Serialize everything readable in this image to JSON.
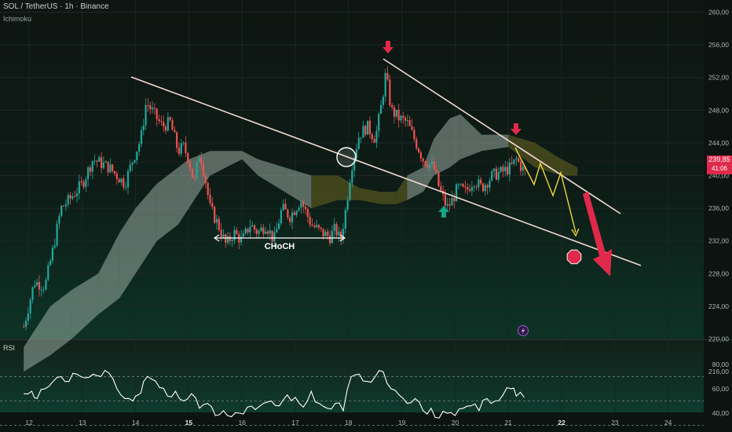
{
  "header": {
    "symbol_line": "SOL / TetherUS · 1h · Binance",
    "indicator": "Ichimoku"
  },
  "colors": {
    "up": "#26a69a",
    "down": "#ef5350",
    "cloud_bull": "#b6c9c1",
    "cloud_bear": "#6b6620",
    "trendline": "#f2d9d2",
    "arrow_down": "#e0294a",
    "arrow_up": "#14a384",
    "projection": "#f1d63a",
    "rsi_line": "#ffffff",
    "price_tag": "#e0294a"
  },
  "icons": {
    "lightning": "lightning-icon",
    "target": "octagon-target-icon"
  },
  "price_tag": {
    "price": "239,85",
    "countdown": "41:06"
  },
  "chart_data": [
    {
      "type": "candlestick",
      "title": "SOL / TetherUS · 1h · Binance",
      "ylim": [
        216,
        262
      ],
      "y_ticks": [
        "260,00",
        "256,00",
        "252,00",
        "248,00",
        "244,00",
        "240,00",
        "236,00",
        "232,00",
        "228,00",
        "224,00",
        "220,00",
        "216,00"
      ],
      "x_ticks": [
        "12",
        "13",
        "14",
        "15",
        "16",
        "17",
        "18",
        "19",
        "20",
        "21",
        "22",
        "23",
        "24"
      ],
      "close_path": [
        {
          "x": 11.9,
          "y": 221.5
        },
        {
          "x": 12.1,
          "y": 227
        },
        {
          "x": 12.3,
          "y": 226.5
        },
        {
          "x": 12.45,
          "y": 231
        },
        {
          "x": 12.6,
          "y": 236
        },
        {
          "x": 12.75,
          "y": 237
        },
        {
          "x": 13.0,
          "y": 239
        },
        {
          "x": 13.2,
          "y": 242
        },
        {
          "x": 13.35,
          "y": 241.5
        },
        {
          "x": 13.5,
          "y": 241
        },
        {
          "x": 13.8,
          "y": 239
        },
        {
          "x": 13.95,
          "y": 242
        },
        {
          "x": 14.1,
          "y": 244.5
        },
        {
          "x": 14.2,
          "y": 249
        },
        {
          "x": 14.35,
          "y": 247.5
        },
        {
          "x": 14.5,
          "y": 246
        },
        {
          "x": 14.65,
          "y": 246.5
        },
        {
          "x": 14.8,
          "y": 243
        },
        {
          "x": 14.9,
          "y": 243.5
        },
        {
          "x": 15.0,
          "y": 242
        },
        {
          "x": 15.1,
          "y": 239
        },
        {
          "x": 15.2,
          "y": 243
        },
        {
          "x": 15.3,
          "y": 240
        },
        {
          "x": 15.4,
          "y": 236
        },
        {
          "x": 15.55,
          "y": 234
        },
        {
          "x": 15.7,
          "y": 231.5
        },
        {
          "x": 15.85,
          "y": 233
        },
        {
          "x": 16.0,
          "y": 232
        },
        {
          "x": 16.15,
          "y": 234
        },
        {
          "x": 16.3,
          "y": 233
        },
        {
          "x": 16.45,
          "y": 234
        },
        {
          "x": 16.6,
          "y": 232
        },
        {
          "x": 16.75,
          "y": 236
        },
        {
          "x": 16.9,
          "y": 235
        },
        {
          "x": 17.1,
          "y": 237
        },
        {
          "x": 17.3,
          "y": 234
        },
        {
          "x": 17.5,
          "y": 233
        },
        {
          "x": 17.65,
          "y": 232.5
        },
        {
          "x": 17.75,
          "y": 233.5
        },
        {
          "x": 17.85,
          "y": 232
        },
        {
          "x": 17.95,
          "y": 236
        },
        {
          "x": 18.05,
          "y": 241
        },
        {
          "x": 18.2,
          "y": 245
        },
        {
          "x": 18.35,
          "y": 246
        },
        {
          "x": 18.5,
          "y": 244.5
        },
        {
          "x": 18.6,
          "y": 248
        },
        {
          "x": 18.7,
          "y": 252.5
        },
        {
          "x": 18.8,
          "y": 248
        },
        {
          "x": 18.95,
          "y": 247
        },
        {
          "x": 19.1,
          "y": 246.5
        },
        {
          "x": 19.2,
          "y": 245
        },
        {
          "x": 19.4,
          "y": 242
        },
        {
          "x": 19.6,
          "y": 241
        },
        {
          "x": 19.7,
          "y": 238.5
        },
        {
          "x": 19.85,
          "y": 236
        },
        {
          "x": 19.95,
          "y": 237
        },
        {
          "x": 20.05,
          "y": 238.5
        },
        {
          "x": 20.2,
          "y": 238
        },
        {
          "x": 20.35,
          "y": 239.5
        },
        {
          "x": 20.5,
          "y": 238.5
        },
        {
          "x": 20.7,
          "y": 240
        },
        {
          "x": 20.9,
          "y": 240.5
        },
        {
          "x": 21.05,
          "y": 241
        },
        {
          "x": 21.15,
          "y": 242
        },
        {
          "x": 21.3,
          "y": 240.5
        }
      ],
      "ichimoku_cloud": [
        {
          "x": 11.9,
          "top": 219,
          "bottom": 216
        },
        {
          "x": 12.4,
          "top": 224,
          "bottom": 218
        },
        {
          "x": 12.8,
          "top": 226,
          "bottom": 220
        },
        {
          "x": 13.3,
          "top": 228,
          "bottom": 223
        },
        {
          "x": 13.7,
          "top": 233,
          "bottom": 225
        },
        {
          "x": 14.0,
          "top": 236,
          "bottom": 228
        },
        {
          "x": 14.4,
          "top": 239,
          "bottom": 232
        },
        {
          "x": 14.8,
          "top": 241,
          "bottom": 234
        },
        {
          "x": 15.0,
          "top": 242,
          "bottom": 236
        },
        {
          "x": 15.4,
          "top": 243,
          "bottom": 240
        },
        {
          "x": 16.0,
          "top": 243,
          "bottom": 242
        },
        {
          "x": 16.3,
          "top": 242,
          "bottom": 240
        },
        {
          "x": 16.8,
          "top": 241,
          "bottom": 238
        },
        {
          "x": 17.3,
          "top": 240,
          "bottom": 236
        },
        {
          "x": 17.8,
          "top": 240,
          "bottom": 237
        },
        {
          "x": 18.2,
          "top": 238.5,
          "bottom": 237
        },
        {
          "x": 18.6,
          "top": 238,
          "bottom": 236.5
        },
        {
          "x": 18.9,
          "top": 238,
          "bottom": 236.5
        },
        {
          "x": 19.1,
          "top": 240,
          "bottom": 237
        },
        {
          "x": 19.4,
          "top": 241,
          "bottom": 238
        },
        {
          "x": 19.6,
          "top": 244.5,
          "bottom": 240
        },
        {
          "x": 19.9,
          "top": 247,
          "bottom": 241
        },
        {
          "x": 20.1,
          "top": 247.5,
          "bottom": 242
        },
        {
          "x": 20.5,
          "top": 245,
          "bottom": 243
        },
        {
          "x": 21.0,
          "top": 245,
          "bottom": 243.5
        },
        {
          "x": 21.5,
          "top": 244,
          "bottom": 241
        },
        {
          "x": 22.0,
          "top": 242,
          "bottom": 240
        },
        {
          "x": 22.3,
          "top": 241,
          "bottom": 240
        }
      ],
      "annotations": {
        "choch_label": "CHoCH"
      }
    },
    {
      "type": "line",
      "title": "RSI",
      "ylim": [
        26,
        80
      ],
      "y_ticks": [
        "80,00",
        "60,00",
        "40,00"
      ],
      "x": [
        11.9,
        12.05,
        12.15,
        12.3,
        12.45,
        12.6,
        12.75,
        12.9,
        13.05,
        13.2,
        13.35,
        13.5,
        13.65,
        13.8,
        13.95,
        14.05,
        14.15,
        14.3,
        14.45,
        14.6,
        14.75,
        14.9,
        15.05,
        15.2,
        15.35,
        15.5,
        15.65,
        15.8,
        15.95,
        16.1,
        16.25,
        16.4,
        16.55,
        16.7,
        16.85,
        17.0,
        17.15,
        17.3,
        17.45,
        17.6,
        17.75,
        17.9,
        18.05,
        18.2,
        18.35,
        18.5,
        18.65,
        18.8,
        18.95,
        19.1,
        19.25,
        19.4,
        19.55,
        19.7,
        19.85,
        20.0,
        20.15,
        20.3,
        20.45,
        20.6,
        20.75,
        20.9,
        21.05,
        21.15,
        21.3
      ],
      "values": [
        56,
        58,
        52,
        60,
        66,
        70,
        66,
        72,
        69,
        72,
        70,
        73,
        60,
        52,
        50,
        55,
        66,
        68,
        61,
        54,
        58,
        50,
        56,
        44,
        48,
        38,
        42,
        37,
        40,
        45,
        43,
        48,
        50,
        46,
        55,
        53,
        45,
        58,
        48,
        44,
        48,
        42,
        70,
        72,
        66,
        70,
        74,
        60,
        55,
        48,
        52,
        42,
        44,
        36,
        40,
        38,
        44,
        46,
        42,
        52,
        50,
        55,
        60,
        54,
        53
      ],
      "reference_lines": [
        70,
        50,
        30
      ]
    }
  ]
}
